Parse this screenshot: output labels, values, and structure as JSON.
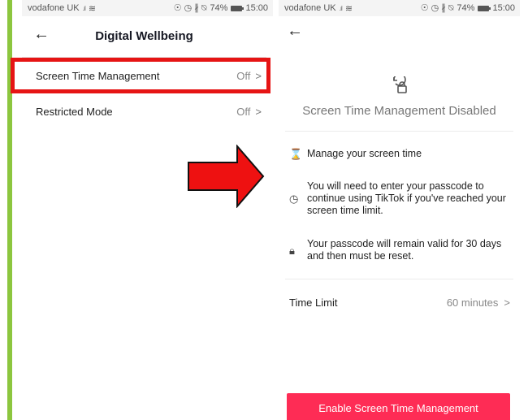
{
  "left_phone": {
    "status": {
      "carrier": "vodafone UK",
      "battery": "74%",
      "time": "15:00"
    },
    "nav": {
      "title": "Digital Wellbeing"
    },
    "rows": [
      {
        "label": "Screen Time Management",
        "value": "Off"
      },
      {
        "label": "Restricted Mode",
        "value": "Off"
      }
    ]
  },
  "right_phone": {
    "status": {
      "carrier": "vodafone UK",
      "battery": "74%",
      "time": "15:00"
    },
    "hero_title": "Screen Time Management Disabled",
    "features": [
      {
        "icon": "hourglass-icon",
        "text": "Manage your screen time"
      },
      {
        "icon": "clock-icon",
        "text": "You will need to enter your passcode to continue using TikTok if you've reached your screen time limit."
      },
      {
        "icon": "lock-icon",
        "text": "Your passcode will remain valid for 30 days and then must be reset."
      }
    ],
    "time_limit": {
      "label": "Time Limit",
      "value": "60 minutes"
    },
    "enable_button": "Enable Screen Time Management"
  },
  "colors": {
    "accent": "#fe2c55",
    "highlight": "#e61414",
    "green_bar": "#8cc63f"
  }
}
